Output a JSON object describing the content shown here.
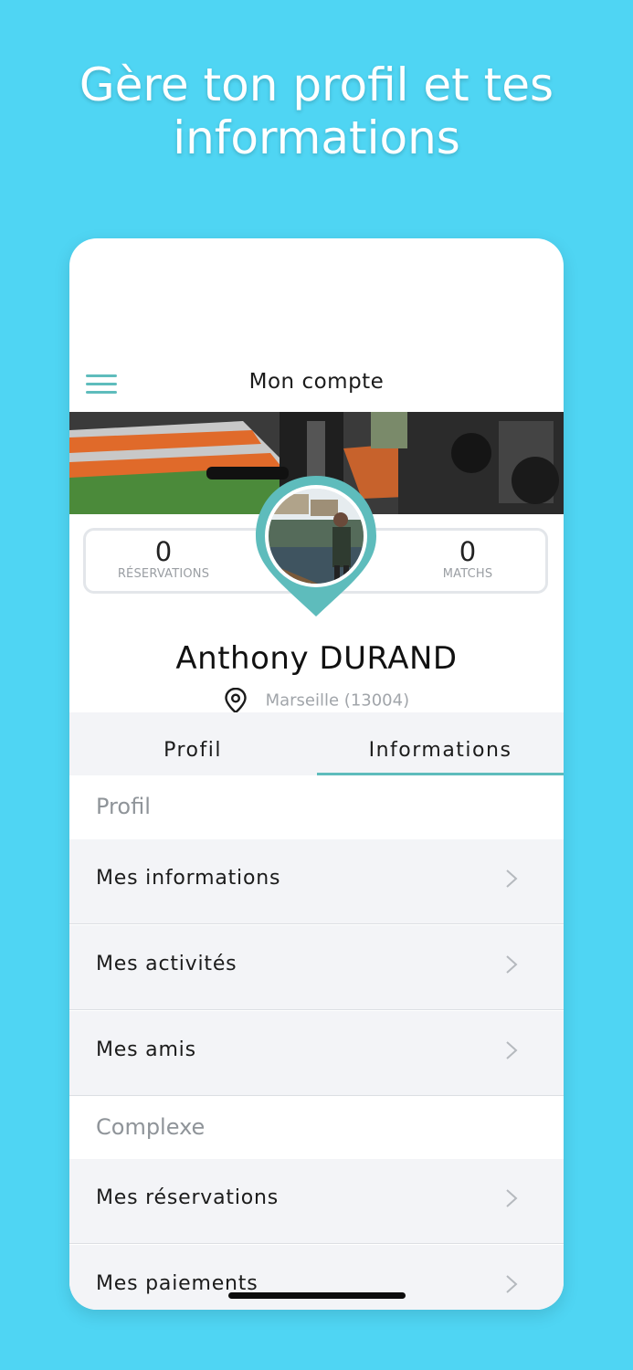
{
  "headline": {
    "line1": "Gère ton profil et tes",
    "line2": "informations"
  },
  "appbar": {
    "title": "Mon compte",
    "menu_icon": "hamburger-menu-icon"
  },
  "stats": {
    "reservations_value": "0",
    "reservations_label": "RÉSERVATIONS",
    "matchs_value": "0",
    "matchs_label": "MATCHS"
  },
  "profile": {
    "name": "Anthony DURAND",
    "location": "Marseille (13004)",
    "location_icon": "location-pin-icon"
  },
  "tabs": [
    {
      "label": "Profil",
      "active": false
    },
    {
      "label": "Informations",
      "active": true
    }
  ],
  "sections": [
    {
      "title": "Profil",
      "items": [
        "Mes informations",
        "Mes activités",
        "Mes amis"
      ]
    },
    {
      "title": "Complexe",
      "items": [
        "Mes réservations",
        "Mes paiements"
      ]
    }
  ],
  "colors": {
    "background": "#4FD5F3",
    "accent": "#5EBCBC",
    "list_bg": "#F3F4F7"
  }
}
